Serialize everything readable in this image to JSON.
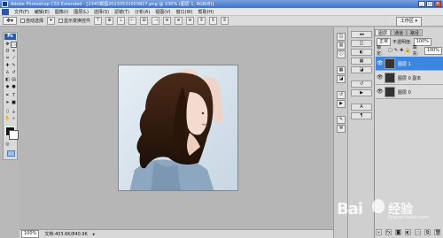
{
  "window": {
    "title": "Adobe Photoshop CS3 Extended - [2345截图20230531003827.png @ 100% (图层 1, RGB/8)]",
    "controls": [
      "_",
      "□",
      "×"
    ]
  },
  "menubar": {
    "items": [
      "文件(F)",
      "编辑(E)",
      "图像(I)",
      "图层(L)",
      "选择(S)",
      "滤镜(T)",
      "分析(A)",
      "视图(V)",
      "窗口(W)",
      "帮助(H)"
    ]
  },
  "optionsbar": {
    "auto_select_label": "自动选择",
    "show_transform_label": "显示变换控件",
    "workspace_label": "工作区 ▾"
  },
  "toolbox": {
    "logo": "Ps",
    "tools": [
      "move-tool",
      "marquee-tool",
      "lasso-tool",
      "magic-wand-tool",
      "crop-tool",
      "slice-tool",
      "healing-tool",
      "brush-tool",
      "stamp-tool",
      "history-brush-tool",
      "eraser-tool",
      "gradient-tool",
      "blur-tool",
      "dodge-tool",
      "pen-tool",
      "type-tool",
      "path-select-tool",
      "shape-tool",
      "notes-tool",
      "eyedropper-tool",
      "hand-tool",
      "zoom-tool"
    ]
  },
  "statusbar": {
    "zoom": "100%",
    "doc_info": "文档:403.6K/840.9K"
  },
  "layers_panel": {
    "tabs": [
      "图层",
      "通道",
      "路径"
    ],
    "blend_mode": "正常",
    "opacity_label": "不透明度:",
    "opacity_value": "100%",
    "lock_label": "锁定:",
    "fill_label": "填充:",
    "fill_value": "100%",
    "layers": [
      {
        "name": "图层 1",
        "selected": true
      },
      {
        "name": "图层 0 副本",
        "selected": false
      },
      {
        "name": "图层 0",
        "selected": false
      }
    ]
  },
  "watermark": {
    "brand": "Bai",
    "text": "经验",
    "sub": "jingyan.baidu.com"
  }
}
